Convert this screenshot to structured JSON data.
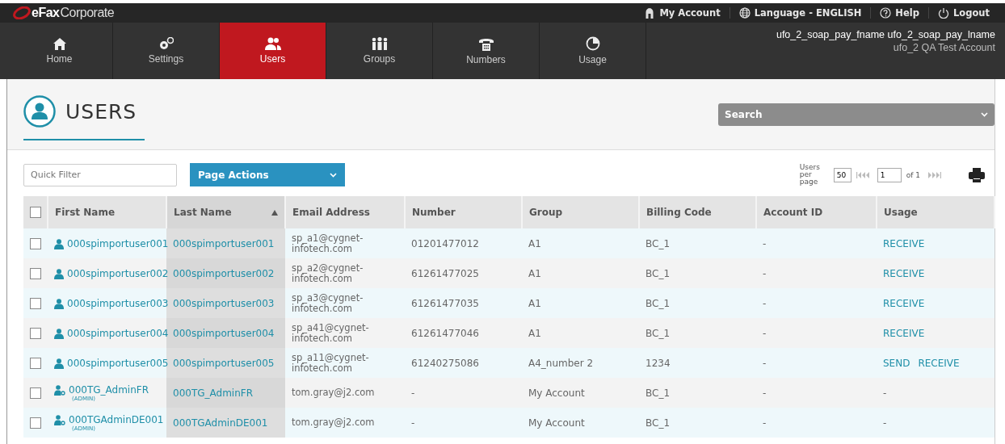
{
  "brand": {
    "name": "eFax",
    "suffix": "Corporate"
  },
  "top_links": [
    {
      "kind": "account",
      "label": "My Account"
    },
    {
      "kind": "language",
      "label": "Language - ENGLISH"
    },
    {
      "kind": "help",
      "label": "Help"
    },
    {
      "kind": "logout",
      "label": "Logout"
    }
  ],
  "nav": [
    {
      "kind": "home",
      "label": "Home",
      "selected": false
    },
    {
      "kind": "settings",
      "label": "Settings",
      "selected": false
    },
    {
      "kind": "users",
      "label": "Users",
      "selected": true
    },
    {
      "kind": "groups",
      "label": "Groups",
      "selected": false
    },
    {
      "kind": "numbers",
      "label": "Numbers",
      "selected": false
    },
    {
      "kind": "usage",
      "label": "Usage",
      "selected": false
    }
  ],
  "user_info": {
    "name": "ufo_2_soap_pay_fname ufo_2_soap_pay_lname",
    "account": "ufo_2 QA Test Account"
  },
  "page_title": "USERS",
  "search": {
    "label": "Search"
  },
  "quick_filter": {
    "placeholder": "Quick Filter"
  },
  "page_actions": {
    "label": "Page Actions"
  },
  "pagination": {
    "per_page_label": "Users per page",
    "per_page": "50",
    "page": "1",
    "of_label": "of 1"
  },
  "table": {
    "select_all_checked": false,
    "columns": [
      {
        "label": "First Name",
        "sorted": false
      },
      {
        "label": "Last Name",
        "sorted": true
      },
      {
        "label": "Email Address",
        "sorted": false
      },
      {
        "label": "Number",
        "sorted": false
      },
      {
        "label": "Group",
        "sorted": false
      },
      {
        "label": "Billing Code",
        "sorted": false
      },
      {
        "label": "Account ID",
        "sorted": false
      },
      {
        "label": "Usage",
        "sorted": false
      }
    ],
    "rows": [
      {
        "checked": false,
        "kind": "user",
        "first_name": "000spimportuser001",
        "last_name": "000spimportuser001",
        "email": "sp_a1@cygnet-infotech.com",
        "number": "01201477012",
        "group": "A1",
        "billing_code": "BC_1",
        "account_id": "-",
        "usage": [
          "RECEIVE"
        ]
      },
      {
        "checked": false,
        "kind": "user",
        "first_name": "000spimportuser002",
        "last_name": "000spimportuser002",
        "email": "sp_a2@cygnet-infotech.com",
        "number": "61261477025",
        "group": "A1",
        "billing_code": "BC_1",
        "account_id": "-",
        "usage": [
          "RECEIVE"
        ]
      },
      {
        "checked": false,
        "kind": "user",
        "first_name": "000spimportuser003",
        "last_name": "000spimportuser003",
        "email": "sp_a3@cygnet-infotech.com",
        "number": "61261477035",
        "group": "A1",
        "billing_code": "BC_1",
        "account_id": "-",
        "usage": [
          "RECEIVE"
        ]
      },
      {
        "checked": false,
        "kind": "user",
        "first_name": "000spimportuser004",
        "last_name": "000spimportuser004",
        "email": "sp_a41@cygnet-infotech.com",
        "number": "61261477046",
        "group": "A1",
        "billing_code": "BC_1",
        "account_id": "-",
        "usage": [
          "RECEIVE"
        ]
      },
      {
        "checked": false,
        "kind": "user",
        "first_name": "000spimportuser005",
        "last_name": "000spimportuser005",
        "email": "sp_a11@cygnet-infotech.com",
        "number": "61240275086",
        "group": "A4_number 2",
        "billing_code": "1234",
        "account_id": "-",
        "usage": [
          "SEND",
          "RECEIVE"
        ]
      },
      {
        "checked": false,
        "kind": "admin",
        "first_name": "000TG_AdminFR",
        "role": "(ADMIN)",
        "last_name": "000TG_AdminFR",
        "email": "tom.gray@j2.com",
        "number": "-",
        "group": "My Account",
        "billing_code": "BC_1",
        "account_id": "-",
        "usage_text": "-"
      },
      {
        "checked": false,
        "kind": "admin",
        "first_name": "000TGAdminDE001",
        "role": "(ADMIN)",
        "last_name": "000TGAdminDE001",
        "email": "tom.gray@j2.com",
        "number": "-",
        "group": "My Account",
        "billing_code": "BC_1",
        "account_id": "-",
        "usage_text": "-"
      }
    ]
  }
}
